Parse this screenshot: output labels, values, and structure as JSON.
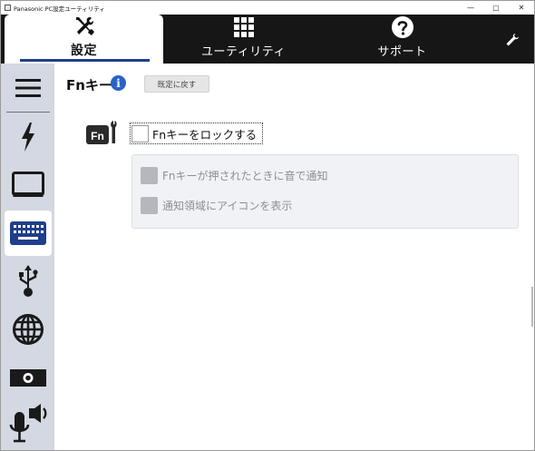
{
  "window": {
    "title": "Panasonic PC設定ユーティリティ",
    "controls": {
      "minimize": "—",
      "maximize": "▢",
      "close": "✕"
    }
  },
  "topnav": {
    "tabs": [
      {
        "label": "設定",
        "icon": "tools-icon",
        "active": true
      },
      {
        "label": "ユーティリティ",
        "icon": "grid-icon",
        "active": false
      },
      {
        "label": "サポート",
        "icon": "question-icon",
        "active": false
      }
    ],
    "wrench_icon": "wrench-icon"
  },
  "sidebar": {
    "items": [
      {
        "icon": "menu-icon"
      },
      {
        "icon": "lightning-icon"
      },
      {
        "icon": "display-icon"
      },
      {
        "icon": "keyboard-icon",
        "active": true
      },
      {
        "icon": "usb-icon"
      },
      {
        "icon": "globe-icon"
      },
      {
        "icon": "camera-icon"
      },
      {
        "icon": "audio-icon"
      }
    ]
  },
  "main": {
    "title": "Fnキー",
    "info_symbol": "i",
    "reset_button": "既定に戻す",
    "fn_logo_text": "Fn",
    "lock_option": {
      "label": "Fnキーをロックする",
      "checked": false
    },
    "sub_options": [
      {
        "label": "Fnキーが押されたときに音で通知",
        "checked": false,
        "enabled": false
      },
      {
        "label": "通知領域にアイコンを表示",
        "checked": false,
        "enabled": false
      }
    ]
  },
  "colors": {
    "topnav_bg": "#161616",
    "sidebar_bg": "#d3d8e2",
    "accent_blue": "#1f3e8c",
    "info_blue": "#2a63c6",
    "disabled_text": "#8d8f94"
  }
}
